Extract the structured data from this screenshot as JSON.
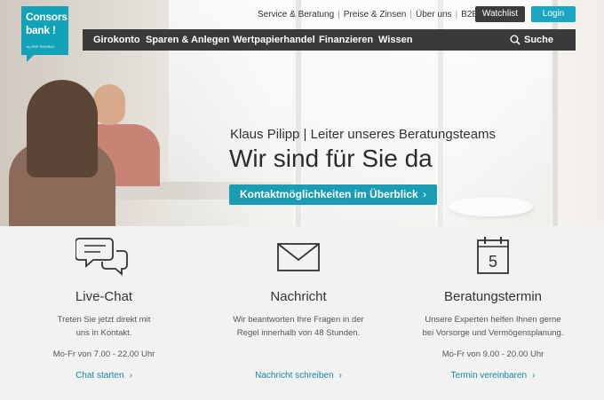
{
  "logo": {
    "line1": "Consors",
    "line2": "bank !",
    "tagline": "by BNP PARIBAS"
  },
  "top_links": [
    "Service & Beratung",
    "Preise & Zinsen",
    "Über uns",
    "B2B"
  ],
  "buttons": {
    "watchlist": "Watchlist",
    "login": "Login"
  },
  "nav": {
    "items": [
      "Girokonto",
      "Sparen & Anlegen",
      "Wertpapierhandel",
      "Finanzieren",
      "Wissen"
    ],
    "search": "Suche"
  },
  "hero": {
    "subtitle": "Klaus Pilipp | Leiter unseres Beratungsteams",
    "title": "Wir sind für Sie da",
    "cta": "Kontaktmöglichkeiten im Überblick",
    "cta_chevron": "›"
  },
  "contact": [
    {
      "icon": "chat-bubbles-icon",
      "title": "Live-Chat",
      "desc1": "Treten Sie jetzt direkt mit",
      "desc2": "uns in Kontakt.",
      "hours": "Mo-Fr von 7.00 - 22.00 Uhr",
      "link": "Chat starten",
      "chevron": "›"
    },
    {
      "icon": "envelope-icon",
      "title": "Nachricht",
      "desc1": "Wir beantworten Ihre Fragen in der",
      "desc2": "Regel innerhalb von 48 Stunden.",
      "hours": "",
      "link": "Nachricht schreiben",
      "chevron": "›"
    },
    {
      "icon": "calendar-icon",
      "title": "Beratungstermin",
      "desc1": "Unsere Experten helfen Ihnen gerne",
      "desc2": "bei Vorsorge und Vermögensplanung.",
      "hours": "Mo-Fr von 9.00 - 20.00 Uhr",
      "link": "Termin vereinbaren",
      "chevron": "›",
      "calendar_day": "5"
    }
  ],
  "colors": {
    "brand": "#13a3b9",
    "cta": "#1a9cb5",
    "nav_bg": "#3a3a3a",
    "link": "#1585a5"
  }
}
